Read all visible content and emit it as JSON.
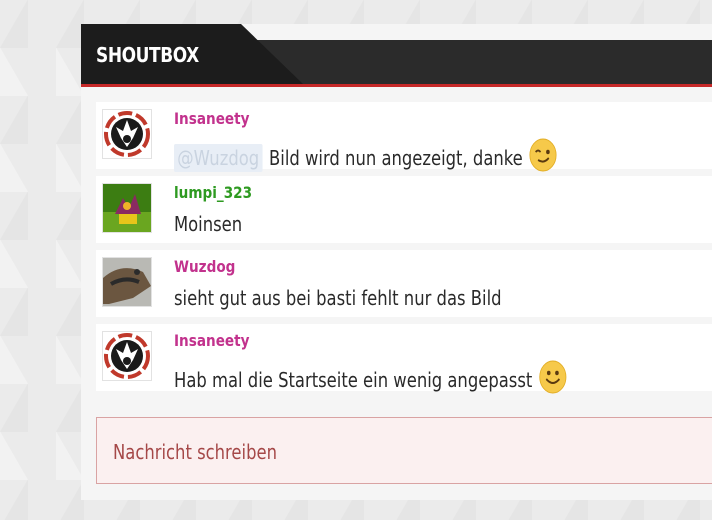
{
  "header": {
    "title": "SHOUTBOX"
  },
  "messages": [
    {
      "author": "Insaneety",
      "name_color": "pink",
      "mention": "@Wuzdog",
      "text": "Bild wird nun angezeigt, danke",
      "emoji": "wink-emoji-icon"
    },
    {
      "author": "lumpi_323",
      "name_color": "green",
      "text": "Moinsen"
    },
    {
      "author": "Wuzdog",
      "name_color": "pink",
      "text": "sieht gut aus bei basti fehlt nur das Bild"
    },
    {
      "author": "Insaneety",
      "name_color": "pink",
      "text": "Hab mal die Startseite ein wenig angepasst",
      "emoji": "smile-emoji-icon"
    }
  ],
  "input": {
    "placeholder": "Nachricht schreiben"
  },
  "colors": {
    "header_bg": "#2b2b2b",
    "accent_red": "#c62828",
    "pink_name": "#c2328d",
    "green_name": "#2e9a21"
  }
}
